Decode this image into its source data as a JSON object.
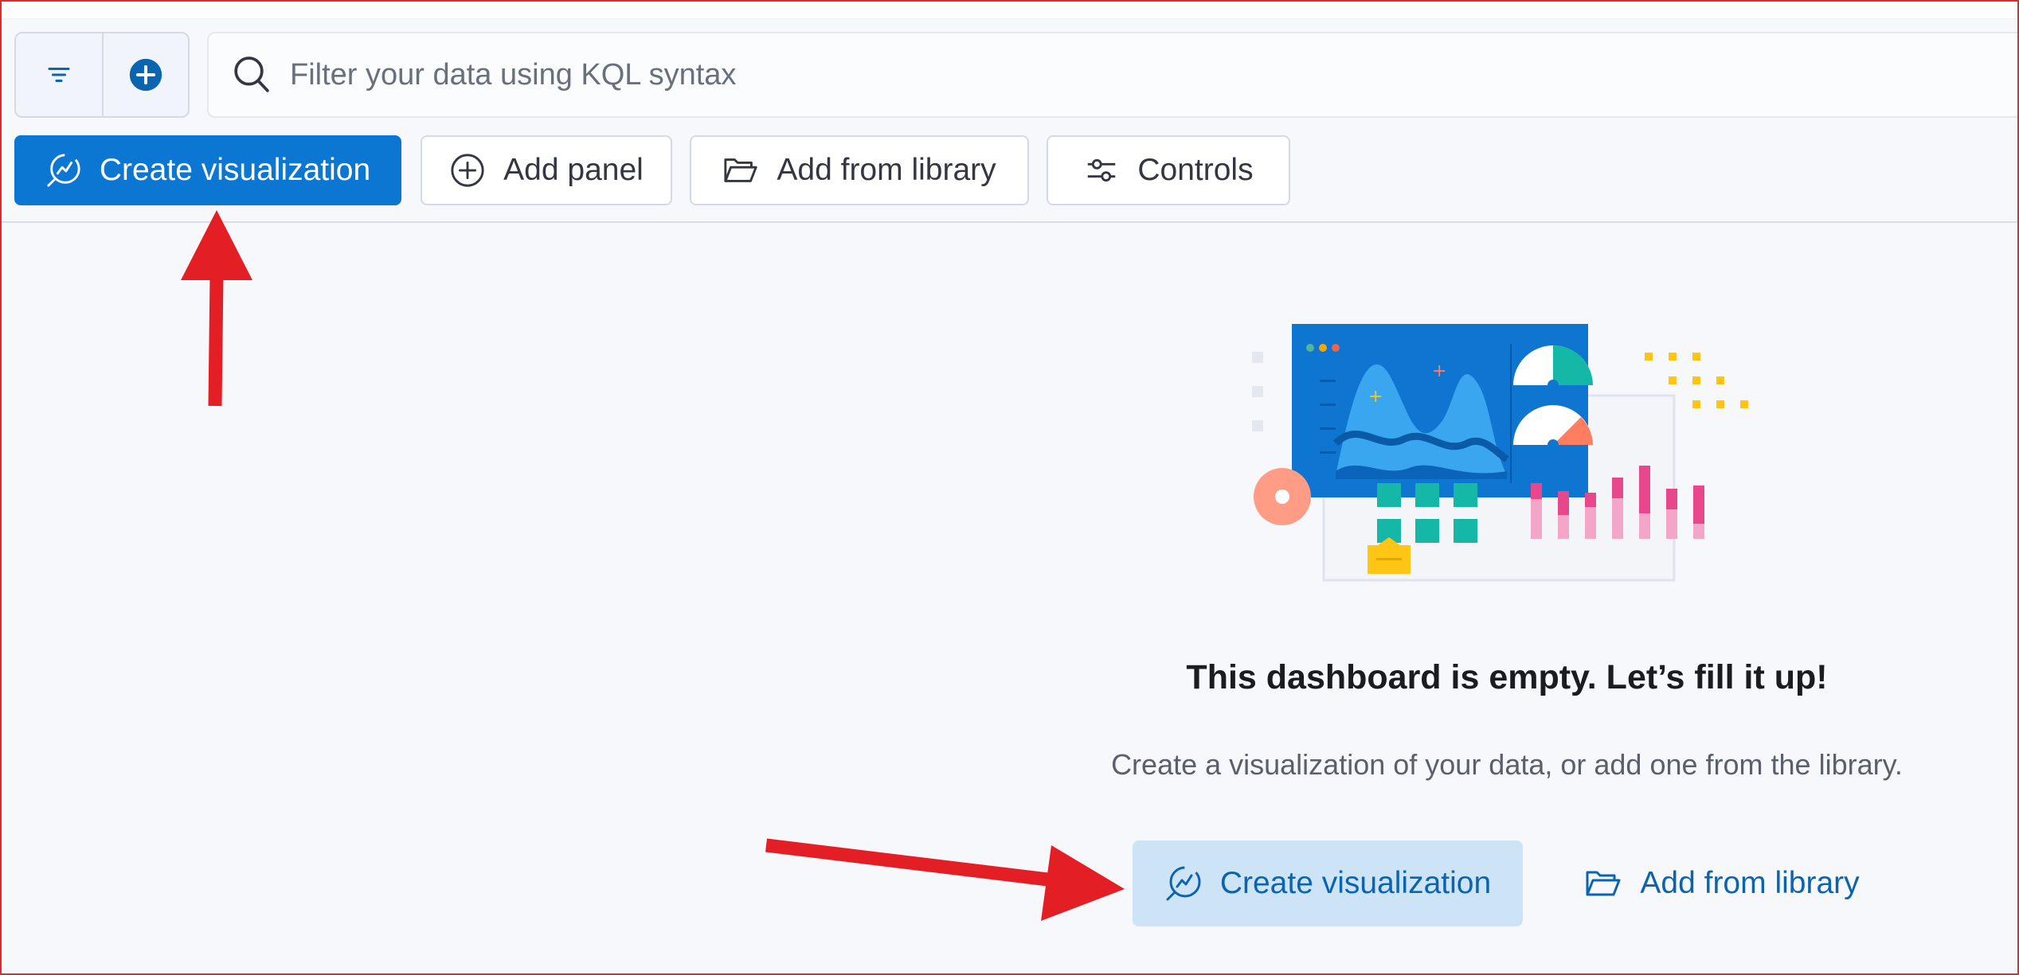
{
  "query_bar": {
    "filter_menu_icon": "filter-lines-icon",
    "add_filter_icon": "plus-circle-icon",
    "search_icon": "magnifier-icon",
    "search_placeholder": "Filter your data using KQL syntax",
    "search_value": ""
  },
  "toolbar": {
    "create_visualization_label": "Create visualization",
    "add_panel_label": "Add panel",
    "add_from_library_label": "Add from library",
    "controls_label": "Controls"
  },
  "empty_state": {
    "title": "This dashboard is empty. Let’s fill it up!",
    "description": "Create a visualization of your data, or add one from the library.",
    "create_visualization_label": "Create visualization",
    "add_from_library_label": "Add from library"
  },
  "colors": {
    "primary": "#0b77d2",
    "primary_light": "#cce4f5",
    "link": "#0b64b0",
    "annotation_arrow": "#e31e24",
    "frame_border": "#e8262b"
  }
}
